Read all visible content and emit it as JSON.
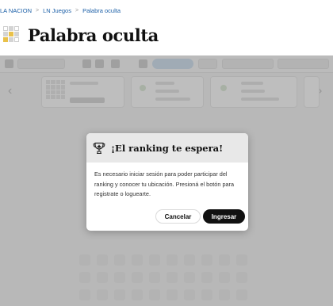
{
  "breadcrumb": {
    "items": [
      "LA NACION",
      "LN Juegos",
      "Palabra oculta"
    ],
    "separator": ">"
  },
  "header": {
    "title": "Palabra oculta",
    "logo_icon": "word-grid-icon"
  },
  "modal": {
    "icon": "trophy-icon",
    "title": "¡El ranking te espera!",
    "body": "Es necesario iniciar sesión para poder participar del ranking y conocer tu ubicación. Presioná el botón para registrate o loguearte.",
    "cancel_label": "Cancelar",
    "confirm_label": "Ingresar"
  },
  "colors": {
    "link": "#1b5fa7",
    "primary_button": "#111111",
    "overlay": "rgba(110,110,110,0.45)",
    "modal_header": "#e8e8e8"
  }
}
